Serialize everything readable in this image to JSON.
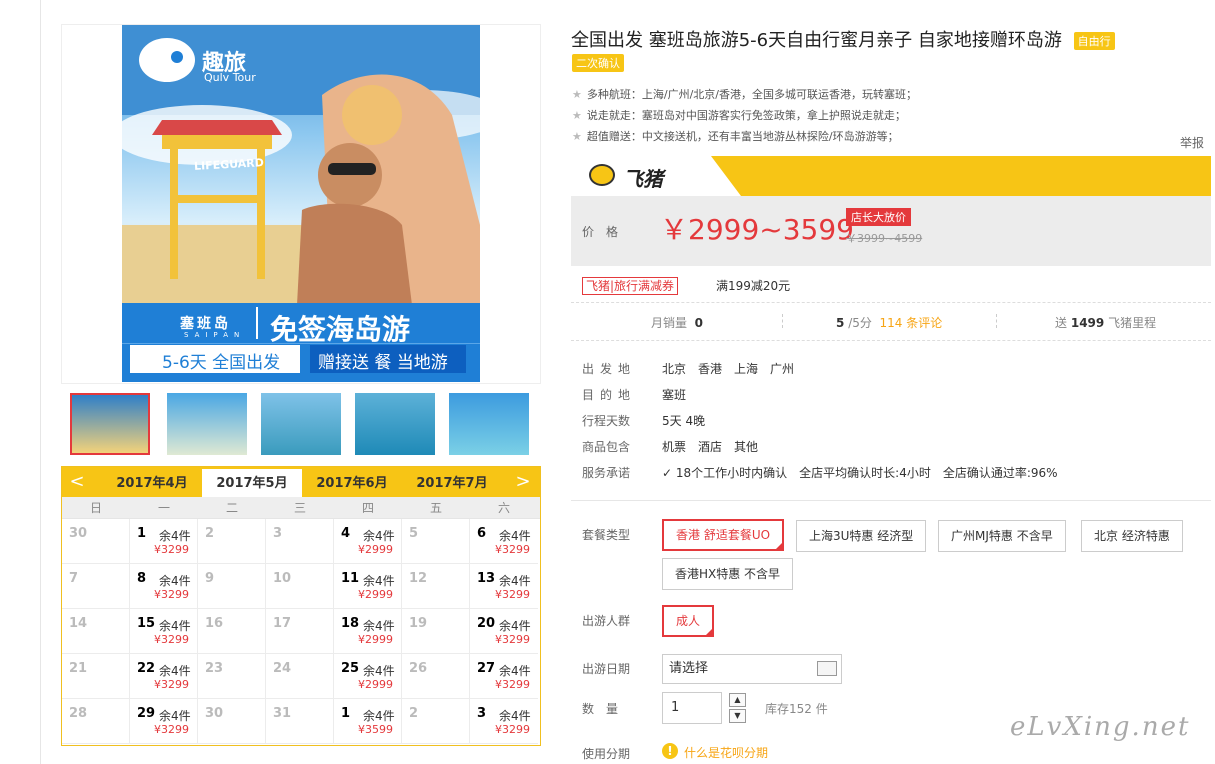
{
  "product": {
    "title": "全国出发 塞班岛旅游5-6天自由行蜜月亲子 自家地接赠环岛游",
    "tag_freetravel": "自由行",
    "tag_confirm": "二次确认",
    "features": [
      "多种航班：上海/广州/北京/香港，全国多城可联运香港，玩转塞班；",
      "说走就走：塞班岛对中国游客实行免签政策，拿上护照说走就走；",
      "超值赠送：中文接送机，还有丰富当地游丛林探险/环岛游游等；"
    ],
    "report": "举报"
  },
  "poster": {
    "brand": "趣旅",
    "brand_sub": "Qulv Tour",
    "lifeguard": "LIFEGUARD",
    "island": "塞班岛",
    "island_en": "SAIPAN",
    "slogan": "免签海岛游",
    "bottom_left": "5-6天 全国出发",
    "bottom_right": "赠接送 餐 当地游"
  },
  "thumbnails": [
    {
      "name": "thumb-poster",
      "colors": [
        "#2f7fc8",
        "#f3d27a"
      ]
    },
    {
      "name": "thumb-beach",
      "colors": [
        "#4aa7e4",
        "#dfe9d3"
      ]
    },
    {
      "name": "thumb-kayak",
      "colors": [
        "#7fc2e8",
        "#3a9bbd"
      ]
    },
    {
      "name": "thumb-boat",
      "colors": [
        "#5db1d8",
        "#1f8ab7"
      ]
    },
    {
      "name": "thumb-lagoon",
      "colors": [
        "#3c9bdf",
        "#7bd0e6"
      ]
    }
  ],
  "calendar": {
    "prev": "<",
    "next": ">",
    "months": [
      "2017年4月",
      "2017年5月",
      "2017年6月",
      "2017年7月"
    ],
    "active_month": 1,
    "weekdays": [
      "日",
      "一",
      "二",
      "三",
      "四",
      "五",
      "六"
    ],
    "rows": [
      [
        {
          "d": "30",
          "off": true
        },
        {
          "d": "1",
          "st": "余4件",
          "pr": "¥3299"
        },
        {
          "d": "2",
          "off": true
        },
        {
          "d": "3",
          "off": true
        },
        {
          "d": "4",
          "st": "余4件",
          "pr": "¥2999"
        },
        {
          "d": "5",
          "off": true
        },
        {
          "d": "6",
          "st": "余4件",
          "pr": "¥3299"
        }
      ],
      [
        {
          "d": "7",
          "off": true
        },
        {
          "d": "8",
          "st": "余4件",
          "pr": "¥3299"
        },
        {
          "d": "9",
          "off": true
        },
        {
          "d": "10",
          "off": true
        },
        {
          "d": "11",
          "st": "余4件",
          "pr": "¥2999"
        },
        {
          "d": "12",
          "off": true
        },
        {
          "d": "13",
          "st": "余4件",
          "pr": "¥3299"
        }
      ],
      [
        {
          "d": "14",
          "off": true
        },
        {
          "d": "15",
          "st": "余4件",
          "pr": "¥3299"
        },
        {
          "d": "16",
          "off": true
        },
        {
          "d": "17",
          "off": true
        },
        {
          "d": "18",
          "st": "余4件",
          "pr": "¥2999"
        },
        {
          "d": "19",
          "off": true
        },
        {
          "d": "20",
          "st": "余4件",
          "pr": "¥3299"
        }
      ],
      [
        {
          "d": "21",
          "off": true
        },
        {
          "d": "22",
          "st": "余4件",
          "pr": "¥3299"
        },
        {
          "d": "23",
          "off": true
        },
        {
          "d": "24",
          "off": true
        },
        {
          "d": "25",
          "st": "余4件",
          "pr": "¥2999"
        },
        {
          "d": "26",
          "off": true
        },
        {
          "d": "27",
          "st": "余4件",
          "pr": "¥3299"
        }
      ],
      [
        {
          "d": "28",
          "off": true
        },
        {
          "d": "29",
          "st": "余4件",
          "pr": "¥3299"
        },
        {
          "d": "30",
          "off": true
        },
        {
          "d": "31",
          "off": true
        },
        {
          "d": "1",
          "st": "余4件",
          "pr": "¥3599"
        },
        {
          "d": "2",
          "off": true
        },
        {
          "d": "3",
          "st": "余4件",
          "pr": "¥3299"
        }
      ]
    ]
  },
  "brand": {
    "name": "飞猪"
  },
  "price": {
    "label": "价格",
    "range": "￥2999~3599",
    "promo": "店长大放价",
    "original": "￥3999~4599"
  },
  "coupon": {
    "badge": "飞猪|旅行满减券",
    "text": "满199减20元"
  },
  "stats": {
    "monthly_label": "月销量",
    "monthly_value": "0",
    "rating_value": "5",
    "rating_suffix": "/5分",
    "reviews": "114 条评论",
    "miles_prefix": "送",
    "miles_value": "1499",
    "miles_suffix": "飞猪里程"
  },
  "info": {
    "depart_label": "出发地",
    "depart_value": "北京　香港　上海　广州",
    "dest_label": "目的地",
    "dest_value": "塞班",
    "days_label": "行程天数",
    "days_value": "5天 4晚",
    "include_label": "商品包含",
    "include_value": "机票　酒店　其他",
    "promise_label": "服务承诺",
    "promise_value": "18个工作小时内确认　全店平均确认时长:4小时　全店确认通过率:96%"
  },
  "options": {
    "package_label": "套餐类型",
    "packages": [
      "香港 舒适套餐UO",
      "上海3U特惠 经济型",
      "广州MJ特惠 不含早",
      "北京 经济特惠",
      "香港HX特惠 不含早"
    ],
    "crowd_label": "出游人群",
    "crowd_value": "成人",
    "date_label": "出游日期",
    "date_placeholder": "请选择",
    "qty_label": "数　量",
    "qty_value": "1",
    "stock": "库存152 件",
    "install_label": "使用分期",
    "install_link": "什么是花呗分期"
  },
  "watermark": "eLvXing.net",
  "colors": {
    "accent": "#f7c515",
    "price": "#e4393c"
  }
}
